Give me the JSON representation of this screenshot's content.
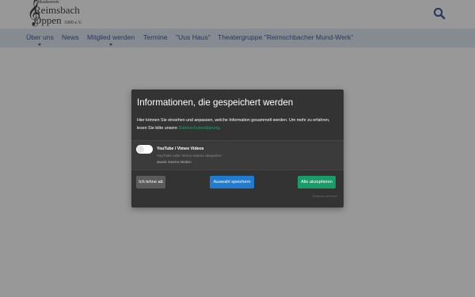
{
  "header": {
    "logo": {
      "small_text": "Musikverein",
      "clef_glyph": "𝄞",
      "line1": "Reimsbach",
      "line2": "Oppen",
      "year": "1909 e.V."
    },
    "search_icon": "search-icon"
  },
  "nav": {
    "items": [
      {
        "label": "Über uns",
        "has_dropdown": true
      },
      {
        "label": "News",
        "has_dropdown": false
      },
      {
        "label": "Mitglied werden",
        "has_dropdown": true
      },
      {
        "label": "Termine",
        "has_dropdown": false
      },
      {
        "label": "\"Uus Haus\"",
        "has_dropdown": false
      },
      {
        "label": "Theatergruppe \"Reimschbacher Mund-Werk\"",
        "has_dropdown": false
      }
    ]
  },
  "consent": {
    "title": "Informationen, die gespeichert werden",
    "description": "Hier können Sie einsehen und anpassen, welche Information gesammelt werden. Um mehr zu erfahren, lesen Sie bitte unsere",
    "privacy_link": "Datenschutzerklärung",
    "description_end": ".",
    "service": {
      "name": "YouTube / Vimeo Videos",
      "description": "YouTube oder Vimeo videos abspielen",
      "purpose": "Zweck: Externe Medien",
      "enabled": false
    },
    "buttons": {
      "decline": "Ich lehne ab",
      "save": "Auswahl speichern",
      "accept": "Alle akzeptieren"
    },
    "powered_by": "Realisiert mit Klaro!"
  },
  "colors": {
    "nav_background": "#d9e4ee",
    "nav_text": "#1f3d8a",
    "dialog_background": "#333333",
    "link": "#22a06b",
    "save_button": "#1f7cd1",
    "accept_button": "#1a9c69",
    "decline_button": "#5b5b5b"
  }
}
